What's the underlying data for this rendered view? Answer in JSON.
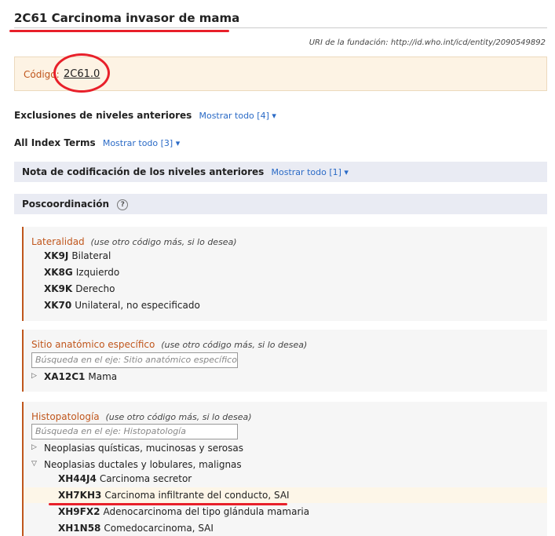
{
  "header": {
    "code": "2C61",
    "title": "Carcinoma invasor de mama",
    "uri": "URI de la fundación: http://id.who.int/icd/entity/2090549892"
  },
  "code_box": {
    "label": "Código:",
    "value": "2C61.0"
  },
  "sections": {
    "exclusions": {
      "label": "Exclusiones de niveles anteriores",
      "show_all": "Mostrar todo [4] ▾"
    },
    "index_terms": {
      "label": "All Index Terms",
      "show_all": "Mostrar todo [3] ▾"
    },
    "coding_note": {
      "label": "Nota de codificación de los niveles anteriores",
      "show_all": "Mostrar todo [1] ▾"
    },
    "postcoord": {
      "label": "Poscoordinación",
      "help": "?"
    }
  },
  "axes": {
    "laterality": {
      "title": "Lateralidad",
      "hint": "(use otro código más, si lo desea)",
      "items": [
        {
          "code": "XK9J",
          "label": "Bilateral"
        },
        {
          "code": "XK8G",
          "label": "Izquierdo"
        },
        {
          "code": "XK9K",
          "label": "Derecho"
        },
        {
          "code": "XK70",
          "label": "Unilateral, no especificado"
        }
      ]
    },
    "site": {
      "title": "Sitio anatómico específico",
      "hint": "(use otro código más, si lo desea)",
      "search_placeholder": "Búsqueda en el eje: Sitio anatómico específico",
      "items": [
        {
          "code": "XA12C1",
          "label": "Mama"
        }
      ]
    },
    "histo": {
      "title": "Histopatología",
      "hint": "(use otro código más, si lo desea)",
      "search_placeholder": "Búsqueda en el eje: Histopatología",
      "groups": [
        {
          "label": "Neoplasias quísticas, mucinosas y serosas"
        },
        {
          "label": "Neoplasias ductales y lobulares, malignas"
        }
      ],
      "items": [
        {
          "code": "XH44J4",
          "label": "Carcinoma secretor"
        },
        {
          "code": "XH7KH3",
          "label": "Carcinoma infiltrante del conducto, SAI"
        },
        {
          "code": "XH9FX2",
          "label": "Adenocarcinoma del tipo glándula mamaria"
        },
        {
          "code": "XH1N58",
          "label": "Comedocarcinoma, SAI"
        }
      ]
    }
  },
  "colors": {
    "accent": "#c0561c",
    "link": "#2a6ac6",
    "annotation": "#e8202a",
    "code_box_bg": "#fdf3e4",
    "band_bg": "#e9ebf3"
  }
}
